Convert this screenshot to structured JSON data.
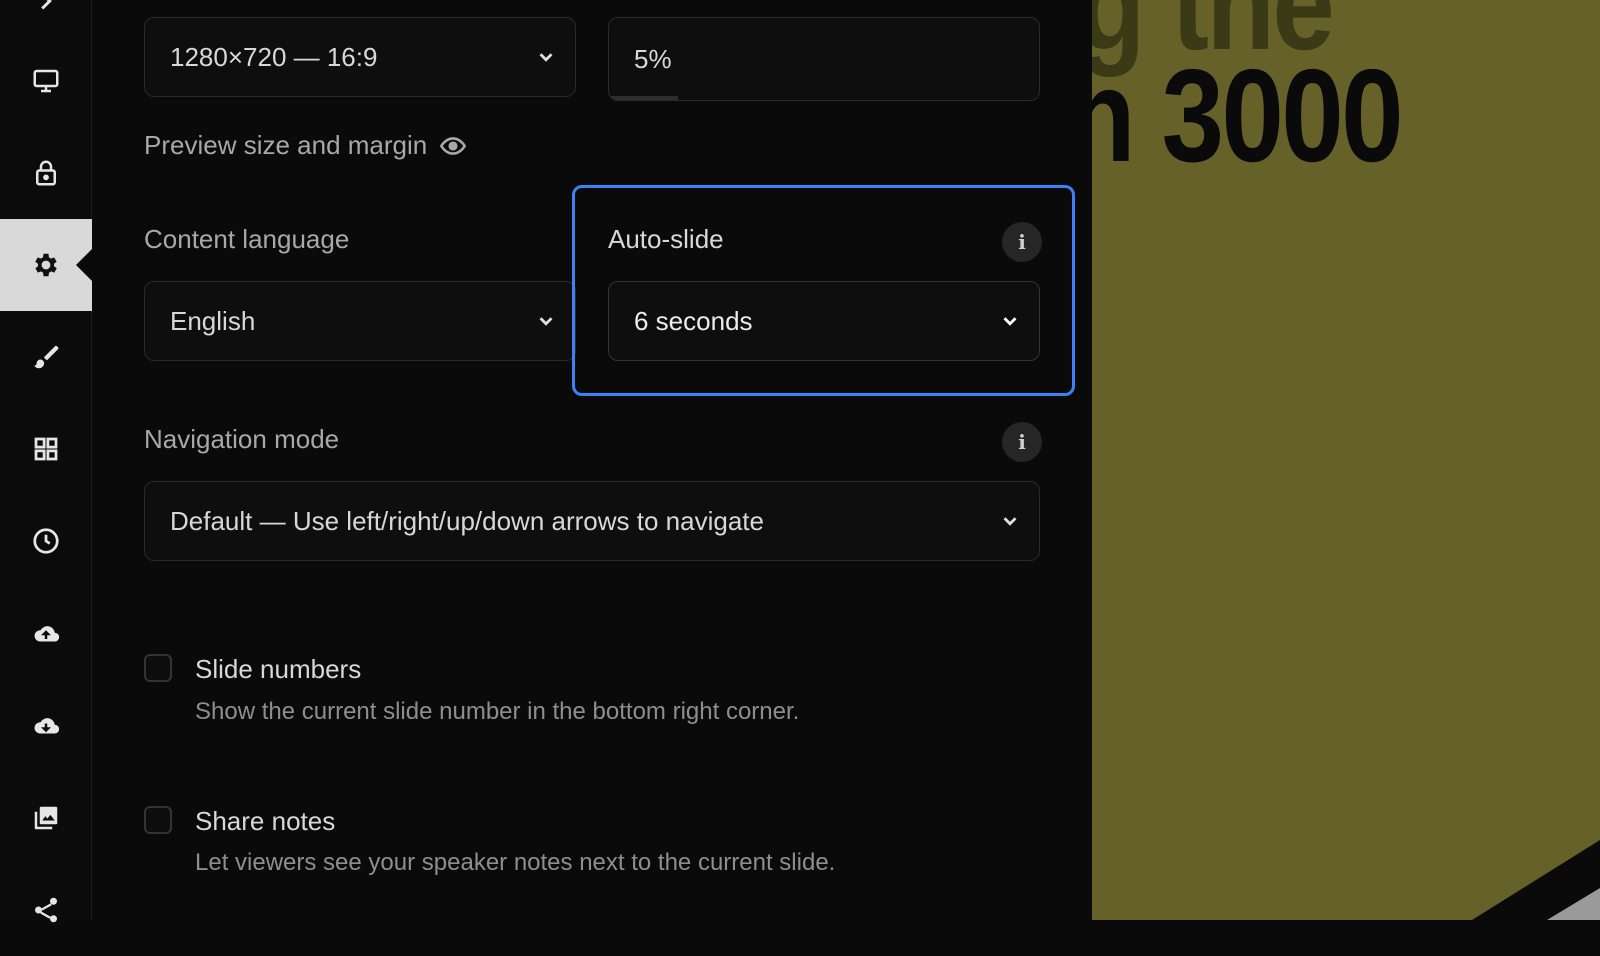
{
  "sidebar": {
    "icons": [
      "monitor-icon",
      "lock-icon",
      "gear-icon",
      "brush-icon",
      "grid-icon",
      "clock-icon",
      "cloud-upload-icon",
      "cloud-download-icon",
      "image-icon",
      "share-icon"
    ],
    "active": "gear-icon"
  },
  "settings": {
    "size_select_value": "1280×720 — 16:9",
    "margin_value": "5%",
    "margin_fill_fraction": 0.16,
    "preview_label": "Preview size and margin",
    "content_language_label": "Content language",
    "content_language_value": "English",
    "auto_slide_label": "Auto-slide",
    "auto_slide_value": "6 seconds",
    "navigation_mode_label": "Navigation mode",
    "navigation_mode_value": "Default — Use left/right/up/down arrows to navigate",
    "info_glyph": "i",
    "slide_numbers_label": "Slide numbers",
    "slide_numbers_desc": "Show the current slide number in the bottom right corner.",
    "slide_numbers_checked": false,
    "share_notes_label": "Share notes",
    "share_notes_desc": "Let viewers see your speaker notes next to the current slide.",
    "share_notes_checked": false
  },
  "preview": {
    "line1": "g the",
    "line2": "n 3000",
    "background_color": "#656128",
    "highlight_color": "#3b82f6"
  }
}
